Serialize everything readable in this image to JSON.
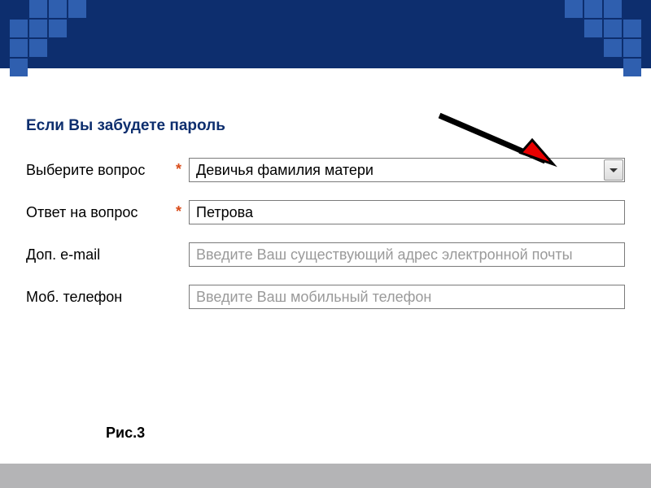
{
  "section_title": "Если Вы забудете пароль",
  "labels": {
    "question": "Выберите вопрос",
    "answer": "Ответ на вопрос",
    "email": "Доп. e-mail",
    "phone": "Моб. телефон"
  },
  "required": "*",
  "fields": {
    "question_value": "Девичья фамилия матери",
    "answer_value": "Петрова",
    "email_placeholder": "Введите Ваш существующий адрес электронной почты",
    "phone_placeholder": "Введите Ваш мобильный телефон"
  },
  "figure_label": "Рис.3"
}
